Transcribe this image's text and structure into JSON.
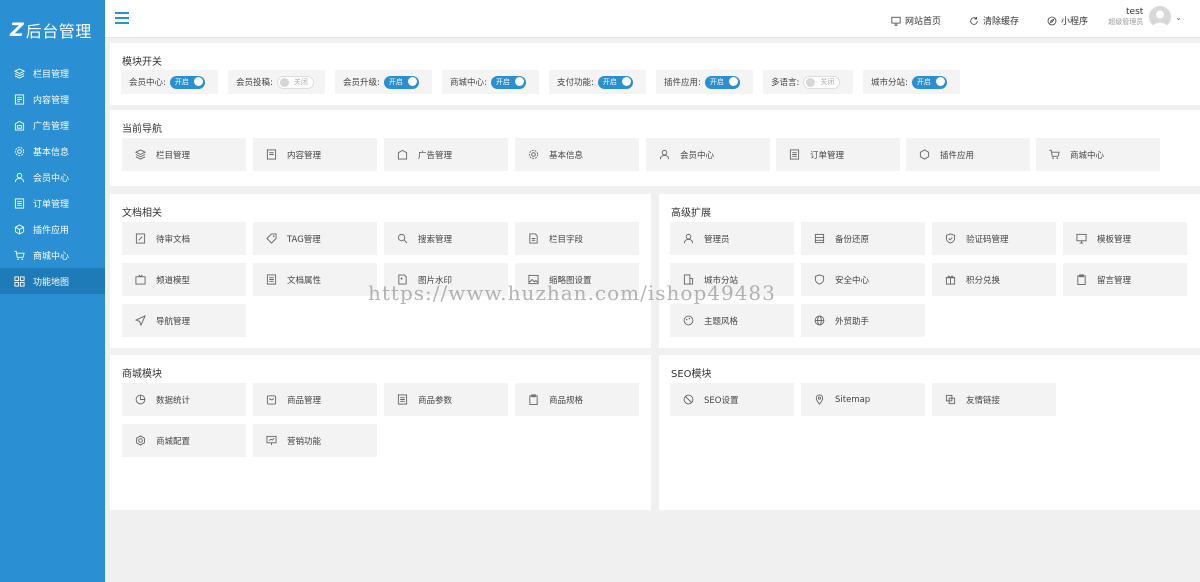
{
  "app": {
    "logo_mark": "Z",
    "title": "后台管理"
  },
  "sidebar": {
    "items": [
      {
        "label": "栏目管理",
        "icon": "layers-icon"
      },
      {
        "label": "内容管理",
        "icon": "document-icon"
      },
      {
        "label": "广告管理",
        "icon": "ad-icon"
      },
      {
        "label": "基本信息",
        "icon": "gear-icon"
      },
      {
        "label": "会员中心",
        "icon": "user-icon"
      },
      {
        "label": "订单管理",
        "icon": "list-icon"
      },
      {
        "label": "插件应用",
        "icon": "cube-icon"
      },
      {
        "label": "商城中心",
        "icon": "cart-icon"
      },
      {
        "label": "功能地图",
        "icon": "grid-icon"
      }
    ]
  },
  "topbar": {
    "site_home": "网站首页",
    "clear_cache": "清除缓存",
    "mini_program": "小程序",
    "user_name": "test",
    "user_role": "超级管理员"
  },
  "module_switch": {
    "title": "模块开关",
    "items": [
      {
        "label": "会员中心:",
        "state": "开启",
        "on": true
      },
      {
        "label": "会员投稿:",
        "state": "关闭",
        "on": false
      },
      {
        "label": "会员升级:",
        "state": "开启",
        "on": true
      },
      {
        "label": "商城中心:",
        "state": "开启",
        "on": true
      },
      {
        "label": "支付功能:",
        "state": "开启",
        "on": true
      },
      {
        "label": "插件应用:",
        "state": "开启",
        "on": true
      },
      {
        "label": "多语言:",
        "state": "关闭",
        "on": false
      },
      {
        "label": "城市分站:",
        "state": "开启",
        "on": true
      }
    ]
  },
  "current_nav": {
    "title": "当前导航",
    "items": [
      "栏目管理",
      "内容管理",
      "广告管理",
      "基本信息",
      "会员中心",
      "订单管理",
      "插件应用",
      "商城中心"
    ]
  },
  "doc": {
    "title": "文档相关",
    "items": [
      "待审文档",
      "TAG管理",
      "搜索管理",
      "栏目字段",
      "频道模型",
      "文档属性",
      "图片水印",
      "缩略图设置",
      "导航管理"
    ]
  },
  "advanced": {
    "title": "高级扩展",
    "items": [
      "管理员",
      "备份还原",
      "验证码管理",
      "模板管理",
      "城市分站",
      "安全中心",
      "积分兑换",
      "留言管理",
      "主题风格",
      "外贸助手"
    ]
  },
  "shop": {
    "title": "商城模块",
    "items": [
      "数据统计",
      "商品管理",
      "商品参数",
      "商品规格",
      "商城配置",
      "营销功能"
    ]
  },
  "seo": {
    "title": "SEO模块",
    "items": [
      "SEO设置",
      "Sitemap",
      "友情链接"
    ]
  },
  "watermark": "https://www.huzhan.com/ishop49483",
  "colors": {
    "accent": "#2a8fd3",
    "sidebar_active": "#1f7ab8"
  }
}
